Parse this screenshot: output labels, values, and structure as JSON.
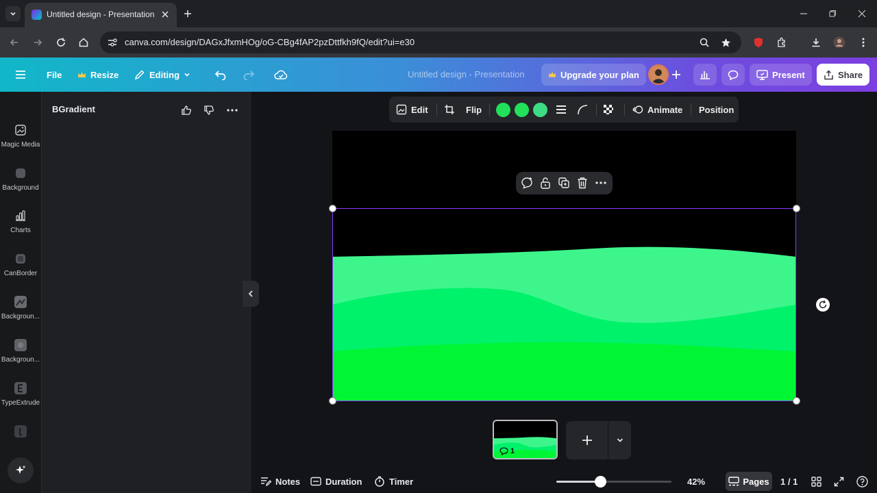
{
  "browser": {
    "tab_title": "Untitled design - Presentation",
    "url": "canva.com/design/DAGxJfxmHOg/oG-CBg4fAP2pzDttfkh9fQ/edit?ui=e30"
  },
  "topbar": {
    "file": "File",
    "resize": "Resize",
    "editing": "Editing",
    "doc_title": "Untitled design - Presentation",
    "upgrade": "Upgrade your plan",
    "present": "Present",
    "share": "Share"
  },
  "rail": {
    "items": [
      {
        "label": "Magic Media",
        "icon": "magic-media-icon"
      },
      {
        "label": "Background",
        "icon": "background-icon"
      },
      {
        "label": "Charts",
        "icon": "charts-icon"
      },
      {
        "label": "CanBorder",
        "icon": "canborder-icon"
      },
      {
        "label": "Backgroun...",
        "icon": "background-app-icon"
      },
      {
        "label": "Backgroun...",
        "icon": "background-app-icon"
      },
      {
        "label": "TypeExtrude",
        "icon": "type-extrude-icon"
      }
    ]
  },
  "panel": {
    "title": "BGradient"
  },
  "context_toolbar": {
    "edit": "Edit",
    "flip": "Flip",
    "animate": "Animate",
    "position": "Position",
    "swatches": [
      "#22e05a",
      "#22e05a",
      "#3ddc84"
    ]
  },
  "design": {
    "colors": {
      "top": "#3ef58c",
      "mid": "#00f26b",
      "bottom": "#00f535",
      "background": "#000000"
    }
  },
  "pages": {
    "thumb_comment_count": "1"
  },
  "footer": {
    "notes": "Notes",
    "duration": "Duration",
    "timer": "Timer",
    "zoom": "42%",
    "zoom_fraction": 0.38,
    "pages": "Pages",
    "page_counter": "1 / 1"
  },
  "accent": "#8b3dff"
}
